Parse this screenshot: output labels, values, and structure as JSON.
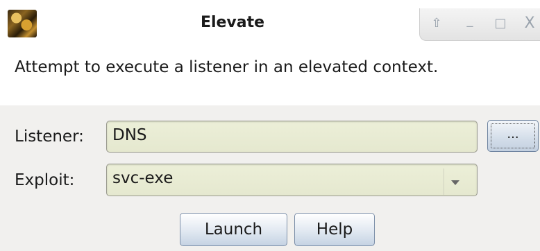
{
  "window": {
    "title": "Elevate",
    "controls": {
      "up_glyph": "⇧",
      "minimize_glyph": "_",
      "maximize_glyph": "□",
      "close_glyph": "X"
    }
  },
  "description": "Attempt to execute a listener in an elevated context.",
  "form": {
    "listener_label": "Listener:",
    "listener_value": "DNS",
    "browse_label": "...",
    "exploit_label": "Exploit:",
    "exploit_value": "svc-exe"
  },
  "buttons": {
    "launch": "Launch",
    "help": "Help"
  },
  "colors": {
    "field_bg": "#e8ebd3",
    "button_accent": "#c5d3e3",
    "panel_bg": "#f1f0ee"
  }
}
